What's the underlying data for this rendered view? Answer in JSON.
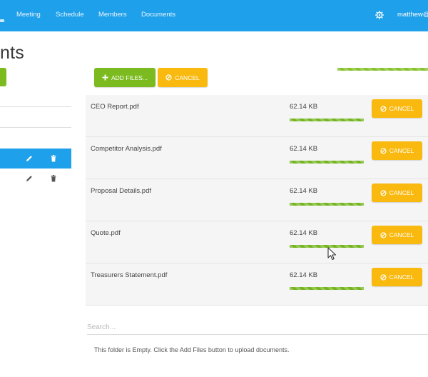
{
  "nav": {
    "items": [
      "Meeting",
      "Schedule",
      "Members",
      "Documents"
    ],
    "user": "matthew@"
  },
  "page": {
    "title": "nts"
  },
  "toolbar": {
    "add_files_label": "ADD FILES...",
    "cancel_label": "CANCEL",
    "total_progress": 1.0
  },
  "files": [
    {
      "name": "CEO Report.pdf",
      "size": "62.14 KB",
      "progress": 1.0,
      "cancel_label": "CANCEL"
    },
    {
      "name": "Competitor Analysis.pdf",
      "size": "62.14 KB",
      "progress": 1.0,
      "cancel_label": "CANCEL"
    },
    {
      "name": "Proposal Details.pdf",
      "size": "62.14 KB",
      "progress": 1.0,
      "cancel_label": "CANCEL"
    },
    {
      "name": "Quote.pdf",
      "size": "62.14 KB",
      "progress": 1.0,
      "cancel_label": "CANCEL"
    },
    {
      "name": "Treasurers Statement.pdf",
      "size": "62.14 KB",
      "progress": 1.0,
      "cancel_label": "CANCEL"
    }
  ],
  "search": {
    "placeholder": "Search...",
    "value": ""
  },
  "empty_message": "This folder is Empty. Click the Add Files button to upload documents.",
  "colors": {
    "nav_bg": "#1fa0ea",
    "green": "#7cbb1f",
    "yellow": "#f9b90f",
    "row_bg": "#f5f5f5"
  },
  "icons": {
    "settings": "gear-icon",
    "add": "plus-icon",
    "cancel": "ban-icon",
    "edit": "pencil-icon",
    "delete": "trash-icon",
    "cursor": "mouse-pointer-icon"
  }
}
